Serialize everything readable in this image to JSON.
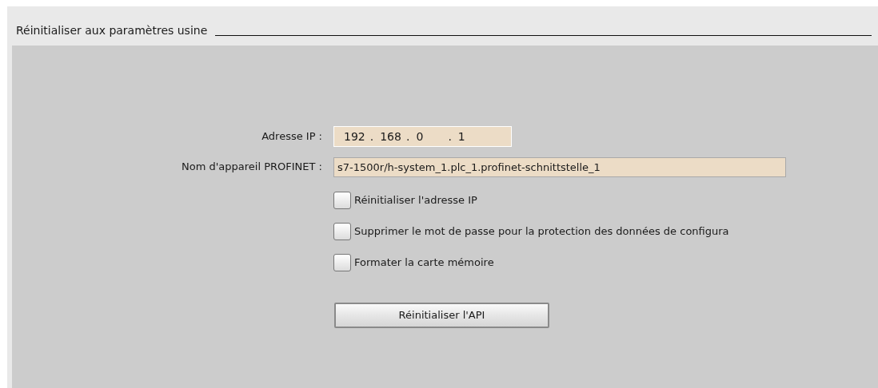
{
  "section": {
    "title": "Réinitialiser aux paramètres usine"
  },
  "ip_address": {
    "label": "Adresse IP :",
    "octets": [
      "192",
      "168",
      "0",
      "1"
    ],
    "separators": [
      ".",
      ".",
      "."
    ]
  },
  "device_name": {
    "label": "Nom d'appareil PROFINET :",
    "value": "s7-1500r/h-system_1.plc_1.profinet-schnittstelle_1"
  },
  "options": [
    {
      "label": "Réinitialiser l'adresse IP",
      "checked": false
    },
    {
      "label": "Supprimer le mot de passe pour la protection des données de configura",
      "checked": false
    },
    {
      "label": "Formater la carte mémoire",
      "checked": false
    }
  ],
  "button": {
    "label": "Réinitialiser l'API"
  }
}
